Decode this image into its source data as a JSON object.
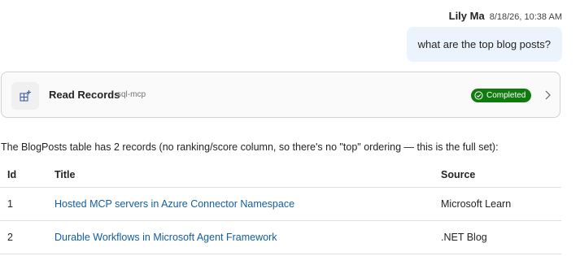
{
  "message": {
    "user_name": "Lily Ma",
    "timestamp": "8/18/26, 10:38 AM",
    "text": "what are the top blog posts?"
  },
  "tool_call": {
    "icon": "table-add-icon",
    "name": "Read Records",
    "server": "sql-mcp",
    "status": "Completed",
    "colors": {
      "status_bg": "#0f7b0f",
      "card_border": "#d1d1d1"
    }
  },
  "response": {
    "summary": "The BlogPosts table has 2 records (no ranking/score column, so there's no \"top\" ordering — this is the full set):",
    "table": {
      "headers": [
        "Id",
        "Title",
        "Source"
      ],
      "rows": [
        {
          "id": "1",
          "title": "Hosted MCP servers in Azure Connector Namespace",
          "source": "Microsoft Learn"
        },
        {
          "id": "2",
          "title": "Durable Workflows in Microsoft Agent Framework",
          "source": ".NET Blog"
        }
      ]
    },
    "colors": {
      "link": "#115ea3"
    }
  }
}
